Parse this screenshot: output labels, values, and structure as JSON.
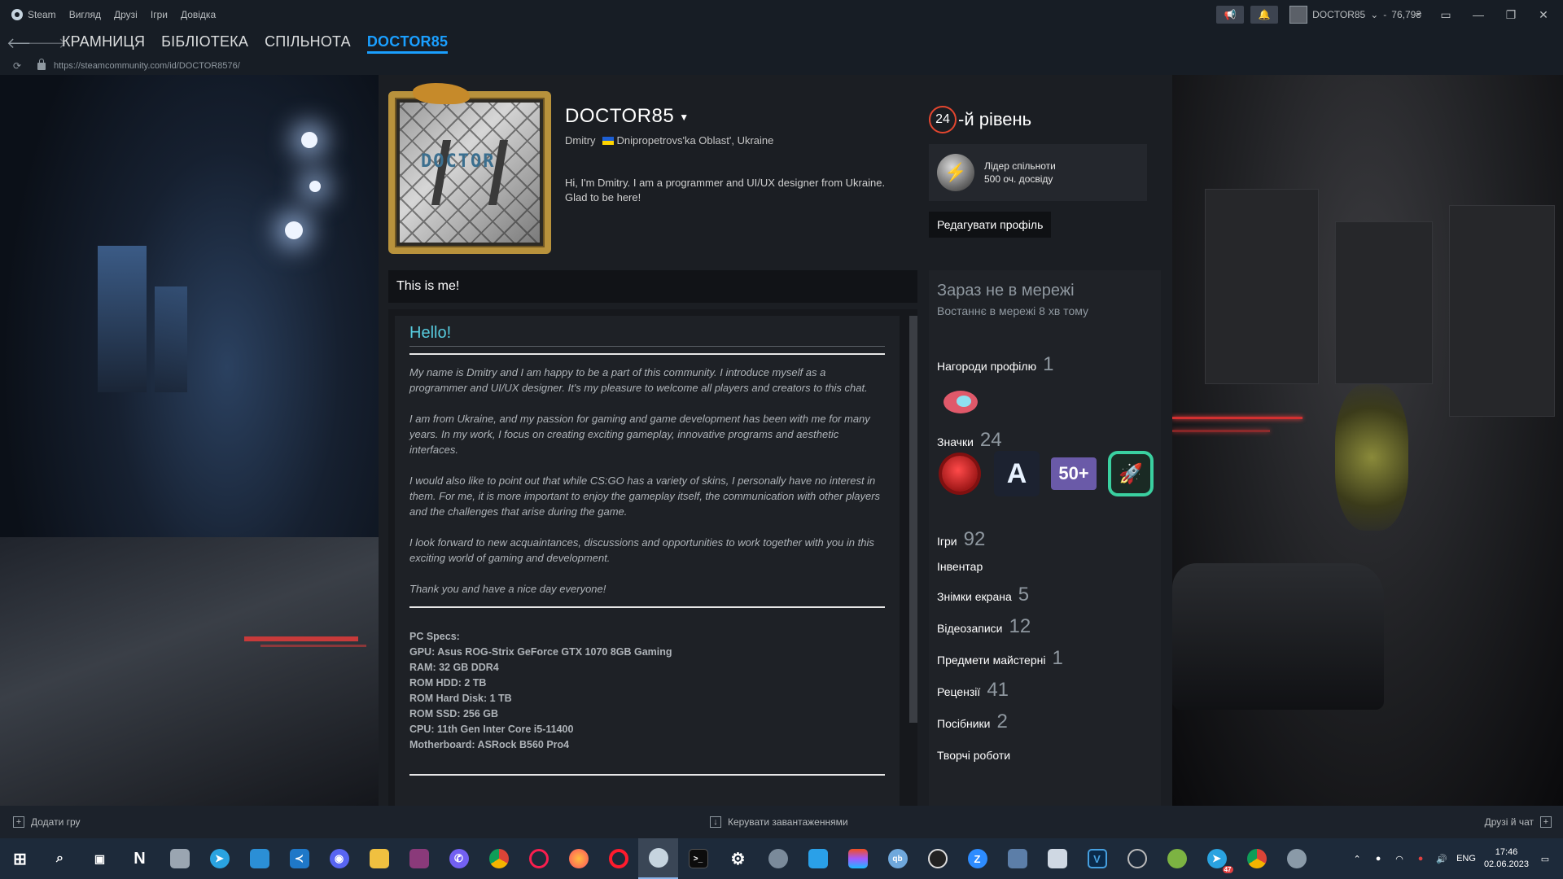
{
  "titlebar": {
    "app": "Steam",
    "menu": [
      "Вигляд",
      "Друзі",
      "Ігри",
      "Довідка"
    ],
    "account_name": "DOCTOR85",
    "wallet": "76,79₴"
  },
  "nav": {
    "links": [
      "КРАМНИЦЯ",
      "БІБЛІОТЕКА",
      "СПІЛЬНОТА",
      "DOCTOR85"
    ],
    "active_index": 3
  },
  "urlbar": {
    "url": "https://steamcommunity.com/id/DOCTOR8576/"
  },
  "profile": {
    "persona_name": "DOCTOR85",
    "real_name": "Dmitry",
    "location": "Dnipropetrovs'ka Oblast', Ukraine",
    "summary": "Hi, I'm Dmitry. I am a programmer and UI/UX designer from Ukraine. Glad to be here!",
    "avatar_text": "DOCTOR",
    "level_number": "24",
    "level_suffix": "-й рівень",
    "featured_badge": {
      "name": "Лідер спільноти",
      "xp": "500 оч. досвіду"
    },
    "edit_button": "Редагувати профіль"
  },
  "showcase": {
    "header": "This is me!",
    "title": "Hello!",
    "paragraphs": [
      "My name is Dmitry and I am happy to be a part of this community. I introduce myself as a programmer and UI/UX designer. It's my pleasure to welcome all players and creators to this chat.",
      "I am from Ukraine, and my passion for gaming and game development has been with me for many years. In my work, I focus on creating exciting gameplay, innovative programs and aesthetic interfaces.",
      "I would also like to point out that while CS:GO has a variety of skins, I personally have no interest in them. For me, it is more important to enjoy the gameplay itself, the communication with other players and the challenges that arise during the game.",
      "I look forward to new acquaintances, discussions and opportunities to work together with you in this exciting world of gaming and development.",
      "Thank you and have a nice day everyone!"
    ],
    "specs": [
      "PC Specs:",
      "GPU: Asus ROG-Strix GeForce GTX 1070 8GB Gaming",
      "RAM: 32 GB DDR4",
      "ROM HDD: 2 TB",
      "ROM Hard Disk: 1 TB",
      "ROM SSD: 256 GB",
      "CPU: 11th Gen Inter Core i5-11400",
      "Motherboard: ASRock B560 Pro4"
    ]
  },
  "sidebar": {
    "status": "Зараз не в мережі",
    "last_online": "Востаннє в мережі 8 хв тому",
    "awards": {
      "label": "Нагороди профілю",
      "count": "1"
    },
    "badges": {
      "label": "Значки",
      "count": "24",
      "items": [
        "",
        "A",
        "50+",
        "🚀"
      ]
    },
    "stats": [
      {
        "label": "Ігри",
        "count": "92"
      },
      {
        "label": "Інвентар",
        "count": ""
      },
      {
        "label": "Знімки екрана",
        "count": "5"
      },
      {
        "label": "Відеозаписи",
        "count": "12"
      },
      {
        "label": "Предмети майстерні",
        "count": "1"
      },
      {
        "label": "Рецензії",
        "count": "41"
      },
      {
        "label": "Посібники",
        "count": "2"
      },
      {
        "label": "Творчі роботи",
        "count": ""
      }
    ]
  },
  "steambar": {
    "add_game": "Додати гру",
    "downloads": "Керувати завантаженнями",
    "friends": "Друзі й чат"
  },
  "taskbar": {
    "apps": [
      "Windows",
      "Пошук",
      "Подання завдань",
      "Notion",
      "Провідник",
      "Telegram",
      "Store",
      "VS Code",
      "Discord",
      "Файли",
      "WinRAR",
      "Viber",
      "Chrome",
      "Opera GX",
      "Firefox",
      "Opera",
      "Steam",
      "Terminal",
      "Налаштування",
      "Stack",
      "Edge",
      "Figma",
      "qBittorrent",
      "OBS",
      "Zoom",
      "Монітор",
      "Нотатки",
      "V",
      "OBS Studio",
      "Android",
      "Telegram",
      "Chrome",
      "Media"
    ],
    "keyboard": "ENG",
    "time": "17:46",
    "date": "02.06.2023",
    "telegram_badge": "47"
  },
  "colors": {
    "accent": "#1a9fff",
    "level_ring": "#e3462f",
    "showcase_title": "#57cbde"
  }
}
